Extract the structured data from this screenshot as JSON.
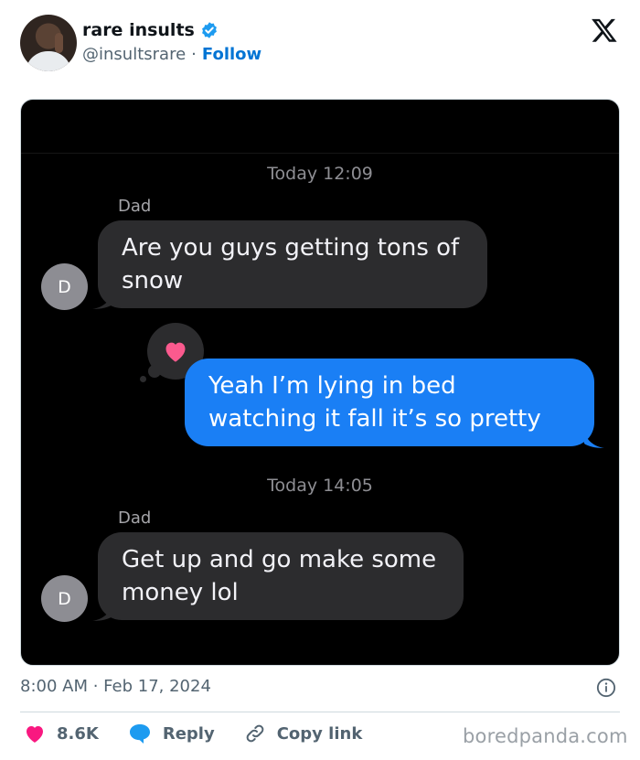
{
  "post": {
    "author_name": "rare insults",
    "handle": "@insultsrare",
    "separator": "·",
    "follow_label": "Follow",
    "timestamp": "8:00 AM · Feb 17, 2024"
  },
  "conversation": {
    "first_time": "Today 12:09",
    "sender_1": "Dad",
    "message_1": "Are you guys getting tons of snow",
    "avatar_letter_1": "D",
    "reply_message": "Yeah I’m lying in bed watching it fall it’s so pretty",
    "reaction": "heart",
    "second_time": "Today 14:05",
    "sender_2": "Dad",
    "message_2": "Get up and go make some money lol",
    "avatar_letter_2": "D"
  },
  "actions": {
    "likes": "8.6K",
    "reply_label": "Reply",
    "copy_link_label": "Copy link"
  },
  "watermark": "boredpanda.com",
  "colors": {
    "follow": "#0074d4",
    "like": "#f91880",
    "reply": "#1d9bf0",
    "imessage_blue": "#1a7ff5",
    "bubble_gray": "#2c2c2e"
  },
  "icons": [
    "verified-badge-icon",
    "x-logo-icon",
    "heart-icon",
    "reply-icon",
    "link-icon",
    "info-icon"
  ]
}
